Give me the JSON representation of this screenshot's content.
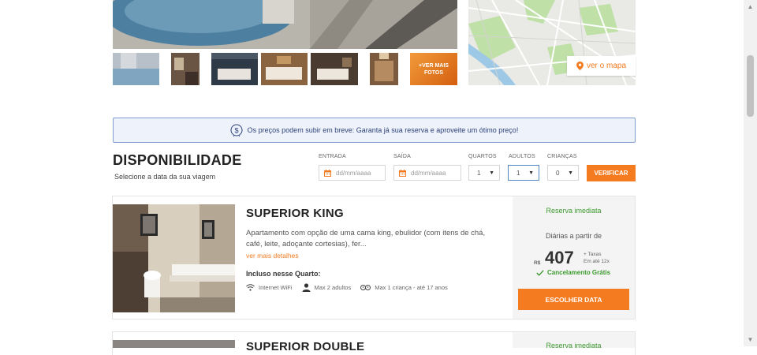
{
  "gallery": {
    "more_photos_label": "+VER MAIS FOTOS",
    "map_button_label": "ver o mapa"
  },
  "banner": {
    "text": "Os preços podem subir em breve: Garanta já sua reserva e aproveite um ótimo preço!"
  },
  "availability": {
    "title": "DISPONIBILIDADE",
    "subtitle": "Selecione a data da sua viagem",
    "checkin_label": "ENTRADA",
    "checkin_placeholder": "dd/mm/aaaa",
    "checkout_label": "SAÍDA",
    "checkout_placeholder": "dd/mm/aaaa",
    "rooms_label": "QUARTOS",
    "rooms_value": "1",
    "adults_label": "ADULTOS",
    "adults_value": "1",
    "children_label": "CRIANÇAS",
    "children_value": "0",
    "verify_label": "VERIFICAR"
  },
  "rooms": [
    {
      "name": "SUPERIOR KING",
      "description": "Apartamento com opção de uma cama king, ebulidor (com itens de chá, café, leite, adoçante cortesias), fer...",
      "more_details": "ver mais detalhes",
      "included_title": "Incluso nesse Quarto:",
      "amenities": [
        "Internet WiFi",
        "Max 2 adultos",
        "Max 1 criança - até 17 anos"
      ],
      "instant_booking": "Reserva imediata",
      "from_label": "Diárias a partir de",
      "currency": "R$",
      "price": "407",
      "tax_line1": "+ Taxas",
      "tax_line2": "Em até 12x",
      "cancellation": "Cancelamento Grátis",
      "choose_label": "ESCOLHER DATA"
    },
    {
      "name": "SUPERIOR DOUBLE",
      "instant_booking": "Reserva imediata"
    }
  ],
  "colors": {
    "accent": "#f47b20",
    "success": "#3c9a2e",
    "banner_border": "#7f9bd0"
  }
}
